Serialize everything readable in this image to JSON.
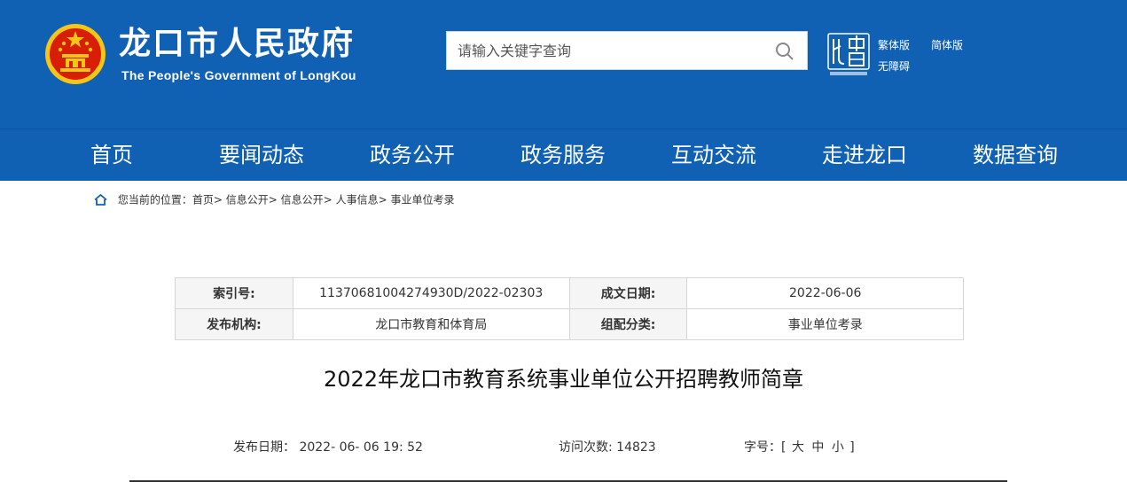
{
  "header": {
    "title": "龙口市人民政府",
    "subtitle": "The People's Government of LongKou",
    "search_placeholder": "请输入关键字查询",
    "links": {
      "traditional": "繁体版",
      "simplified": "简体版",
      "accessible": "无障碍"
    },
    "colors": {
      "brand_blue": "#1060b4",
      "emblem_red": "#d81e06",
      "emblem_gold": "#f5c518"
    }
  },
  "nav": {
    "items": [
      "首页",
      "要闻动态",
      "政务公开",
      "政务服务",
      "互动交流",
      "走进龙口",
      "数据查询"
    ]
  },
  "breadcrumb": {
    "prefix": "您当前的位置：",
    "items": [
      "首页",
      "信息公开",
      "信息公开",
      "人事信息",
      "事业单位考录"
    ],
    "separator": ">"
  },
  "info": {
    "index_label": "索引号:",
    "index_value": "11370681004274930D/2022-02303",
    "date_label": "成文日期:",
    "date_value": "2022-06-06",
    "publisher_label": "发布机构:",
    "publisher_value": "龙口市教育和体育局",
    "category_label": "组配分类:",
    "category_value": "事业单位考录"
  },
  "article": {
    "title": "2022年龙口市教育系统事业单位公开招聘教师简章",
    "publish_label": "发布日期：",
    "publish_value": "2022- 06- 06 19: 52",
    "visits_label": "访问次数:",
    "visits_value": "14823",
    "font_label": "字号：[",
    "font_large": "大",
    "font_medium": "中",
    "font_small": "小",
    "font_close": "]"
  }
}
